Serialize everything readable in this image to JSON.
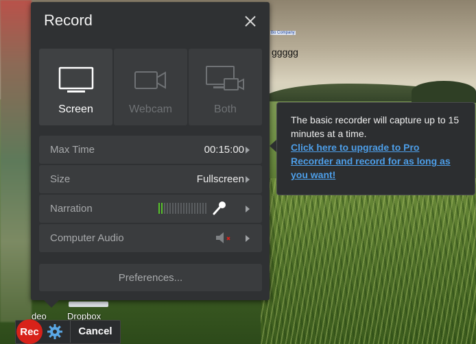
{
  "desktop": {
    "file_label": "Bo Company",
    "text": "ggggg",
    "labels": [
      "deo",
      "Dropbox"
    ]
  },
  "panel": {
    "title": "Record",
    "close_icon": "close-icon",
    "modes": [
      {
        "label": "Screen",
        "icon": "monitor-icon",
        "active": true
      },
      {
        "label": "Webcam",
        "icon": "webcam-icon",
        "active": false
      },
      {
        "label": "Both",
        "icon": "screen-and-webcam-icon",
        "active": false
      }
    ],
    "rows": {
      "max_time": {
        "label": "Max Time",
        "value": "00:15:00"
      },
      "size": {
        "label": "Size",
        "value": "Fullscreen"
      },
      "narration": {
        "label": "Narration",
        "level_bars_on": 2,
        "level_bars_total": 18,
        "icon": "microphone-icon"
      },
      "computer_audio": {
        "label": "Computer Audio",
        "icon": "speaker-muted-icon"
      }
    },
    "preferences_label": "Preferences..."
  },
  "tooltip": {
    "text": "The basic recorder will capture up to 15 minutes at a time.",
    "link": "Click here to upgrade to Pro Recorder and record for as long as you want!"
  },
  "toolbar": {
    "rec_label": "Rec",
    "settings_icon": "gear-icon",
    "cancel_label": "Cancel"
  },
  "colors": {
    "panel_bg": "#2f3133",
    "link": "#4d9ee8",
    "rec": "#d8221a",
    "meter_on": "#57c22a"
  }
}
